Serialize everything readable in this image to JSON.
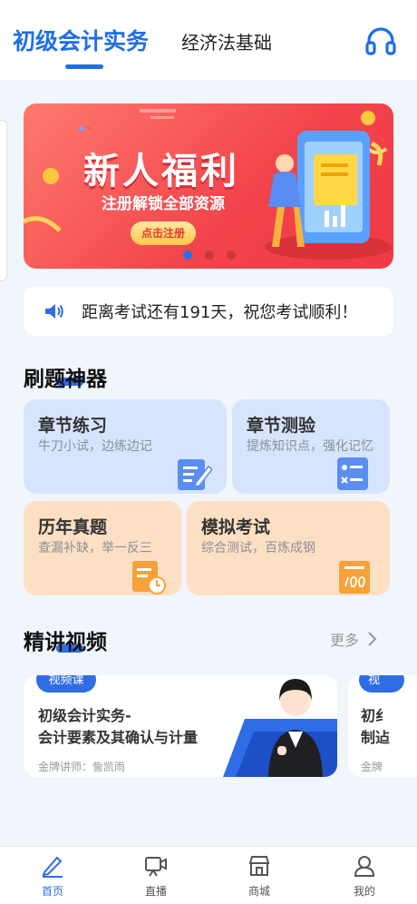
{
  "header": {
    "tabs": [
      {
        "label": "初级会计实务",
        "active": true
      },
      {
        "label": "经济法基础",
        "active": false
      }
    ],
    "service_icon": "headset-icon"
  },
  "banner": {
    "title": "新人福利",
    "subtitle": "注册解锁全部资源",
    "button": "点击注册",
    "carousel_count": 3,
    "carousel_active": 1
  },
  "notice": {
    "icon": "speaker-icon",
    "text": "距离考试还有191天，祝您考试顺利！"
  },
  "practice": {
    "title": "刷题神器",
    "cards": [
      {
        "title": "章节练习",
        "subtitle": "牛刀小试，边练边记",
        "icon": "edit-icon",
        "color": "#d6e5fd"
      },
      {
        "title": "章节测验",
        "subtitle": "提炼知识点，强化记忆",
        "icon": "checklist-icon",
        "color": "#d6e5fd"
      },
      {
        "title": "历年真题",
        "subtitle": "查漏补缺，举一反三",
        "icon": "history-paper-icon",
        "color": "#fde0c4"
      },
      {
        "title": "模拟考试",
        "subtitle": "综合测试，百炼成钢",
        "icon": "score-paper-icon",
        "color": "#fde0c4"
      }
    ]
  },
  "videos": {
    "title": "精讲视频",
    "more": "更多",
    "items": [
      {
        "badge": "视频课",
        "title_line1": "初级会计实务-",
        "title_line2": "会计要素及其确认与计量",
        "teacher": "金牌讲师：訾凯雨"
      },
      {
        "badge": "视",
        "title_line1": "初纟",
        "title_line2": "制迠",
        "teacher": "金牌"
      }
    ]
  },
  "bottom_nav": [
    {
      "label": "首页",
      "icon": "home-pen-icon",
      "active": true
    },
    {
      "label": "直播",
      "icon": "live-camera-icon",
      "active": false
    },
    {
      "label": "商城",
      "icon": "shop-icon",
      "active": false
    },
    {
      "label": "我的",
      "icon": "user-icon",
      "active": false
    }
  ],
  "colors": {
    "accent": "#2f6de6",
    "banner": "#f2434b",
    "card_blue": "#d6e5fd",
    "card_orange": "#fde0c4"
  }
}
